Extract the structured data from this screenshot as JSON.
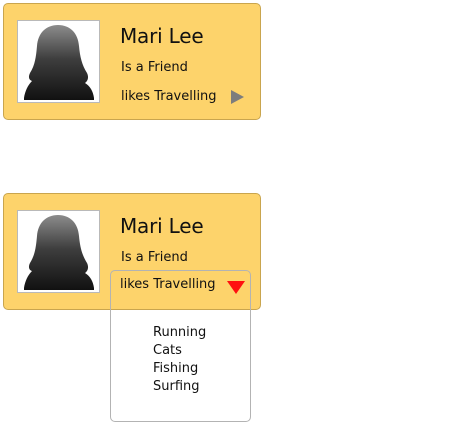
{
  "profiles": [
    {
      "avatar_icon": "person-silhouette-icon",
      "name": "Mari Lee",
      "relation": "Is a Friend",
      "interest": "likes Travelling",
      "toggle_icon": "triangle-right-icon",
      "toggle_color": "#7d7d7d",
      "expanded": false
    },
    {
      "avatar_icon": "person-silhouette-icon",
      "name": "Mari Lee",
      "relation": "Is a Friend",
      "interest": "likes Travelling",
      "toggle_icon": "triangle-down-icon",
      "toggle_color": "#ff1010",
      "expanded": true,
      "options": [
        "Running",
        "Cats",
        "Fishing",
        "Surfing"
      ]
    }
  ],
  "colors": {
    "card_background": "#fdd36b",
    "card_border": "#c9a54e",
    "text": "#111111"
  }
}
